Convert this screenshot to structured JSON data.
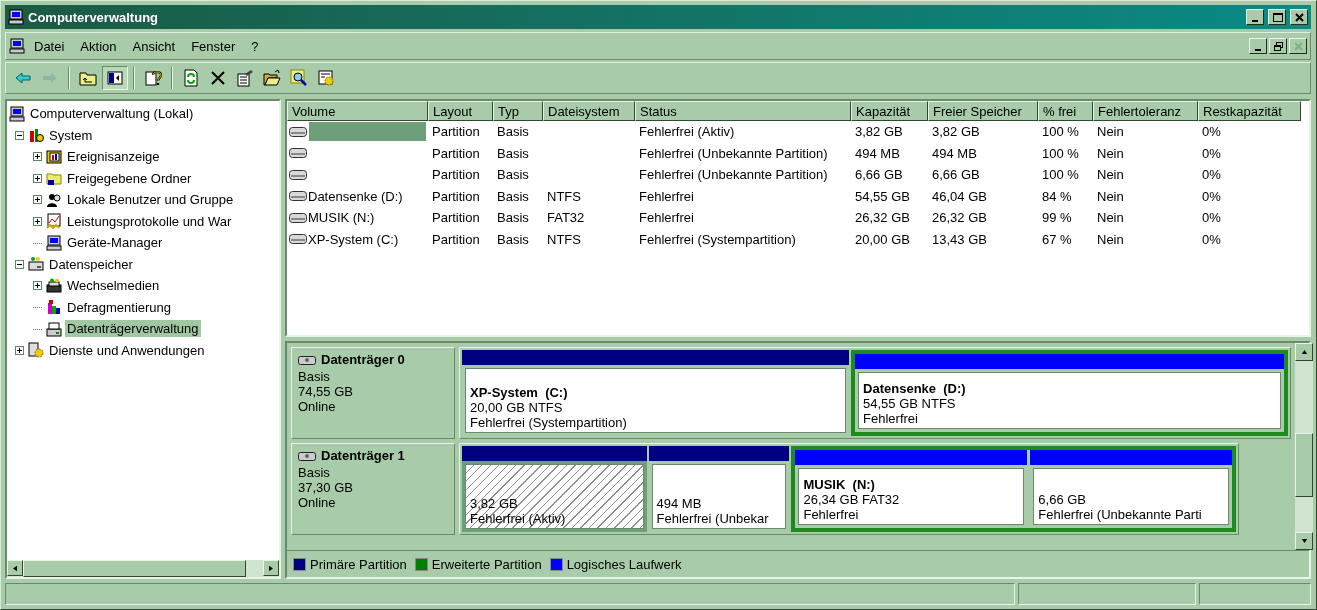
{
  "window": {
    "title": "Computerverwaltung"
  },
  "title_controls": [
    {
      "kind": "minimize",
      "disabled": false
    },
    {
      "kind": "maximize",
      "disabled": false
    },
    {
      "kind": "close",
      "disabled": false
    }
  ],
  "menu_bar": [
    "Datei",
    "Aktion",
    "Ansicht",
    "Fenster",
    "?"
  ],
  "mdi_controls": [
    {
      "kind": "minimize",
      "disabled": false
    },
    {
      "kind": "restore",
      "disabled": false
    },
    {
      "kind": "close",
      "disabled": true
    }
  ],
  "toolbar": [
    {
      "kind": "back",
      "disabled": false,
      "pressed": false
    },
    {
      "kind": "forward",
      "disabled": true,
      "pressed": false
    },
    {
      "kind": "separator"
    },
    {
      "kind": "up",
      "disabled": false,
      "pressed": false
    },
    {
      "kind": "tree",
      "disabled": false,
      "pressed": true
    },
    {
      "kind": "separator"
    },
    {
      "kind": "help",
      "disabled": false,
      "pressed": false
    },
    {
      "kind": "separator"
    },
    {
      "kind": "refresh",
      "disabled": false,
      "pressed": false
    },
    {
      "kind": "delete",
      "disabled": false,
      "pressed": false
    },
    {
      "kind": "properties",
      "disabled": false,
      "pressed": false
    },
    {
      "kind": "open",
      "disabled": false,
      "pressed": false
    },
    {
      "kind": "search",
      "disabled": false,
      "pressed": false
    },
    {
      "kind": "settings",
      "disabled": false,
      "pressed": false
    }
  ],
  "tree": [
    {
      "label": "Computerverwaltung (Lokal)",
      "kind": "computer",
      "selected": false,
      "children": [
        {
          "label": "System",
          "kind": "tools",
          "expanded": true,
          "selected": false,
          "children": [
            {
              "label": "Ereignisanzeige",
              "kind": "events",
              "expanded": false,
              "selected": false
            },
            {
              "label": "Freigegebene Ordner",
              "kind": "folder",
              "expanded": false,
              "selected": false
            },
            {
              "label": "Lokale Benutzer und Gruppe",
              "kind": "users",
              "expanded": false,
              "selected": false
            },
            {
              "label": "Leistungsprotokolle und War",
              "kind": "perf",
              "expanded": false,
              "selected": false
            },
            {
              "label": "Geräte-Manager",
              "kind": "devices",
              "selected": false
            }
          ]
        },
        {
          "label": "Datenspeicher",
          "kind": "storage",
          "expanded": true,
          "selected": false,
          "children": [
            {
              "label": "Wechselmedien",
              "kind": "media",
              "expanded": false,
              "selected": false
            },
            {
              "label": "Defragmentierung",
              "kind": "defrag",
              "selected": false
            },
            {
              "label": "Datenträgerverwaltung",
              "kind": "diskmgmt",
              "selected": true
            }
          ]
        },
        {
          "label": "Dienste und Anwendungen",
          "kind": "services",
          "expanded": false,
          "selected": false
        }
      ]
    }
  ],
  "table": {
    "columns": [
      "Volume",
      "Layout",
      "Typ",
      "Dateisystem",
      "Status",
      "Kapazität",
      "Freier Speicher",
      "% frei",
      "Fehlertoleranz",
      "Restkapazität"
    ],
    "rows": [
      {
        "selected": true,
        "layout": "Partition",
        "type": "Basis",
        "status": "Fehlerfrei (Aktiv)",
        "capacity": "3,82 GB",
        "free": "3,82 GB",
        "percent_free": "100 %",
        "fault_tolerance": "Nein",
        "overhead": "0%"
      },
      {
        "selected": false,
        "layout": "Partition",
        "type": "Basis",
        "status": "Fehlerfrei (Unbekannte Partition)",
        "capacity": "494 MB",
        "free": "494 MB",
        "percent_free": "100 %",
        "fault_tolerance": "Nein",
        "overhead": "0%"
      },
      {
        "selected": false,
        "layout": "Partition",
        "type": "Basis",
        "status": "Fehlerfrei (Unbekannte Partition)",
        "capacity": "6,66 GB",
        "free": "6,66 GB",
        "percent_free": "100 %",
        "fault_tolerance": "Nein",
        "overhead": "0%"
      },
      {
        "selected": false,
        "volume": "Datensenke (D:)",
        "layout": "Partition",
        "type": "Basis",
        "file_system": "NTFS",
        "status": "Fehlerfrei",
        "capacity": "54,55 GB",
        "free": "46,04 GB",
        "percent_free": "84 %",
        "fault_tolerance": "Nein",
        "overhead": "0%"
      },
      {
        "selected": false,
        "volume": "MUSIK (N:)",
        "layout": "Partition",
        "type": "Basis",
        "file_system": "FAT32",
        "status": "Fehlerfrei",
        "capacity": "26,32 GB",
        "free": "26,32 GB",
        "percent_free": "99 %",
        "fault_tolerance": "Nein",
        "overhead": "0%"
      },
      {
        "selected": false,
        "volume": "XP-System (C:)",
        "layout": "Partition",
        "type": "Basis",
        "file_system": "NTFS",
        "status": "Fehlerfrei (Systempartition)",
        "capacity": "20,00 GB",
        "free": "13,43 GB",
        "percent_free": "67 %",
        "fault_tolerance": "Nein",
        "overhead": "0%"
      }
    ]
  },
  "disks": [
    {
      "name": "Datenträger 0",
      "type": "Basis",
      "size": "74,55 GB",
      "status": "Online",
      "partitions": [
        {
          "kind": "primary",
          "selected": false,
          "name": "XP-System  (C:)",
          "size": "20,00 GB NTFS",
          "status": "Fehlerfrei (Systempartition)"
        },
        {
          "kind": "extended",
          "children": [
            {
              "kind": "logical",
              "selected": false,
              "name": "Datensenke  (D:)",
              "size": "54,55 GB NTFS",
              "status": "Fehlerfrei"
            }
          ]
        }
      ]
    },
    {
      "name": "Datenträger 1",
      "type": "Basis",
      "size": "37,30 GB",
      "status": "Online",
      "partitions": [
        {
          "kind": "primary",
          "selected": true,
          "size": "3,82 GB",
          "status": "Fehlerfrei (Aktiv)"
        },
        {
          "kind": "primary",
          "selected": false,
          "size": "494 MB",
          "status": "Fehlerfrei (Unbekar"
        },
        {
          "kind": "extended",
          "children": [
            {
              "kind": "logical",
              "selected": false,
              "name": "MUSIK  (N:)",
              "size": "26,34 GB FAT32",
              "status": "Fehlerfrei"
            },
            {
              "kind": "logical",
              "selected": false,
              "size": "6,66 GB",
              "status": "Fehlerfrei (Unbekannte Parti"
            }
          ]
        }
      ]
    }
  ],
  "legend": [
    {
      "label": "Primäre Partition",
      "color": "#000080"
    },
    {
      "label": "Erweiterte Partition",
      "color": "#008000"
    },
    {
      "label": "Logisches Laufwerk",
      "color": "#0000ff"
    }
  ]
}
